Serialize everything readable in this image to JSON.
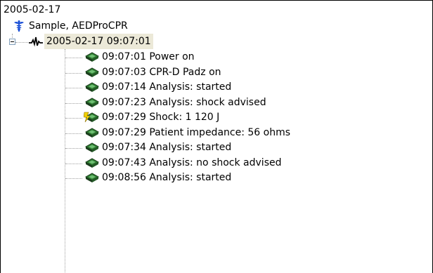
{
  "tree": {
    "date_header": "2005-02-17",
    "patient": {
      "label": "Sample, AEDProCPR",
      "icon": "caduceus-icon"
    },
    "session": {
      "label": "2005-02-17 09:07:01",
      "icon": "ecg-waveform-icon",
      "expanded": true,
      "selected": true
    },
    "events": [
      {
        "label": "09:07:01 Power on",
        "icon": "aed-device-icon"
      },
      {
        "label": "09:07:03 CPR-D Padz on",
        "icon": "aed-device-icon"
      },
      {
        "label": "09:07:14 Analysis: started",
        "icon": "aed-device-icon"
      },
      {
        "label": "09:07:23 Analysis: shock advised",
        "icon": "aed-device-icon"
      },
      {
        "label": "09:07:29 Shock: 1 120 J",
        "icon": "aed-shock-icon"
      },
      {
        "label": "09:07:29 Patient impedance: 56 ohms",
        "icon": "aed-device-icon"
      },
      {
        "label": "09:07:34 Analysis: started",
        "icon": "aed-device-icon"
      },
      {
        "label": "09:07:43 Analysis: no shock advised",
        "icon": "aed-device-icon"
      },
      {
        "label": "09:08:56 Analysis: started",
        "icon": "aed-device-icon"
      }
    ],
    "colors": {
      "device_green": "#2f7d32",
      "device_dark": "#1b3d1d",
      "bolt_yellow": "#f2d100",
      "caduceus_blue": "#1a4fd6",
      "selection": "#ece9d8"
    }
  }
}
